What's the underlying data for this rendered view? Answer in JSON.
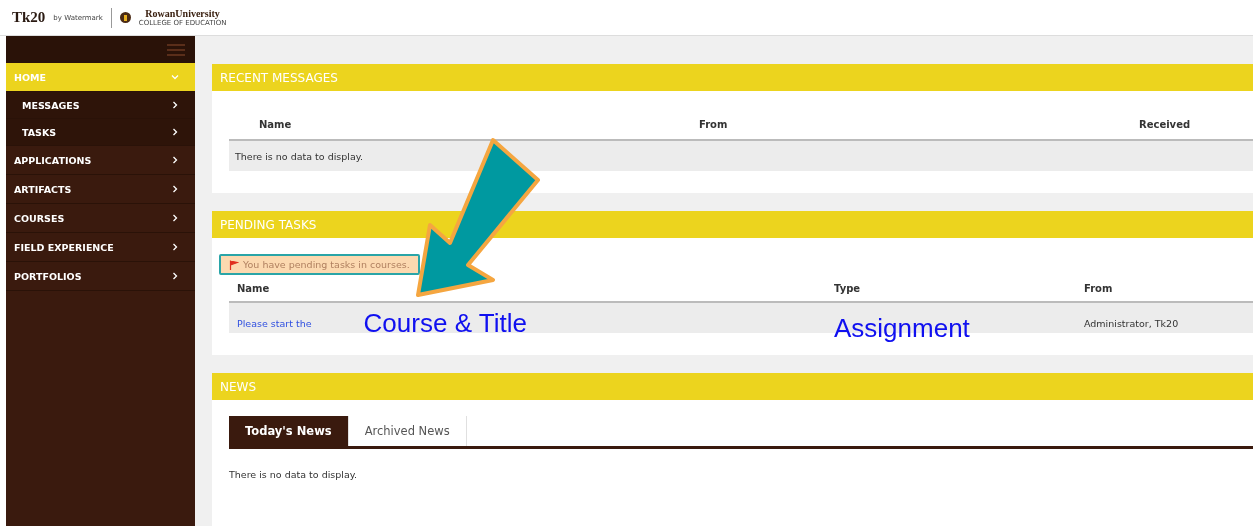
{
  "header": {
    "logo": "Tk20",
    "logo_by": "by Watermark",
    "partner": "RowanUniversity",
    "partner_sub": "COLLEGE OF EDUCATION"
  },
  "sidebar": {
    "items": [
      {
        "label": "HOME",
        "selected": true,
        "expanded": true,
        "children": [
          {
            "label": "MESSAGES",
            "selected": false
          },
          {
            "label": "TASKS",
            "selected": false
          }
        ]
      },
      {
        "label": "APPLICATIONS",
        "selected": false,
        "expanded": false
      },
      {
        "label": "ARTIFACTS",
        "selected": false,
        "expanded": false
      },
      {
        "label": "COURSES",
        "selected": false,
        "expanded": false
      },
      {
        "label": "FIELD EXPERIENCE",
        "selected": false,
        "expanded": false
      },
      {
        "label": "PORTFOLIOS",
        "selected": false,
        "expanded": false
      }
    ]
  },
  "recent_messages": {
    "title": "RECENT MESSAGES",
    "columns": [
      "Name",
      "From",
      "Received"
    ],
    "empty_text": "There is no data to display."
  },
  "pending_tasks": {
    "title": "PENDING TASKS",
    "alert": "You have pending tasks in courses.",
    "columns": [
      "Name",
      "Type",
      "From"
    ],
    "rows": [
      {
        "name": "Please start the",
        "note": "Course & Title",
        "type": "Assignment",
        "from": "Administrator, Tk20"
      }
    ]
  },
  "news": {
    "title": "NEWS",
    "tabs": [
      {
        "label": "Today's News",
        "selected": true
      },
      {
        "label": "Archived News",
        "selected": false
      }
    ],
    "empty_text": "There is no data to display."
  }
}
